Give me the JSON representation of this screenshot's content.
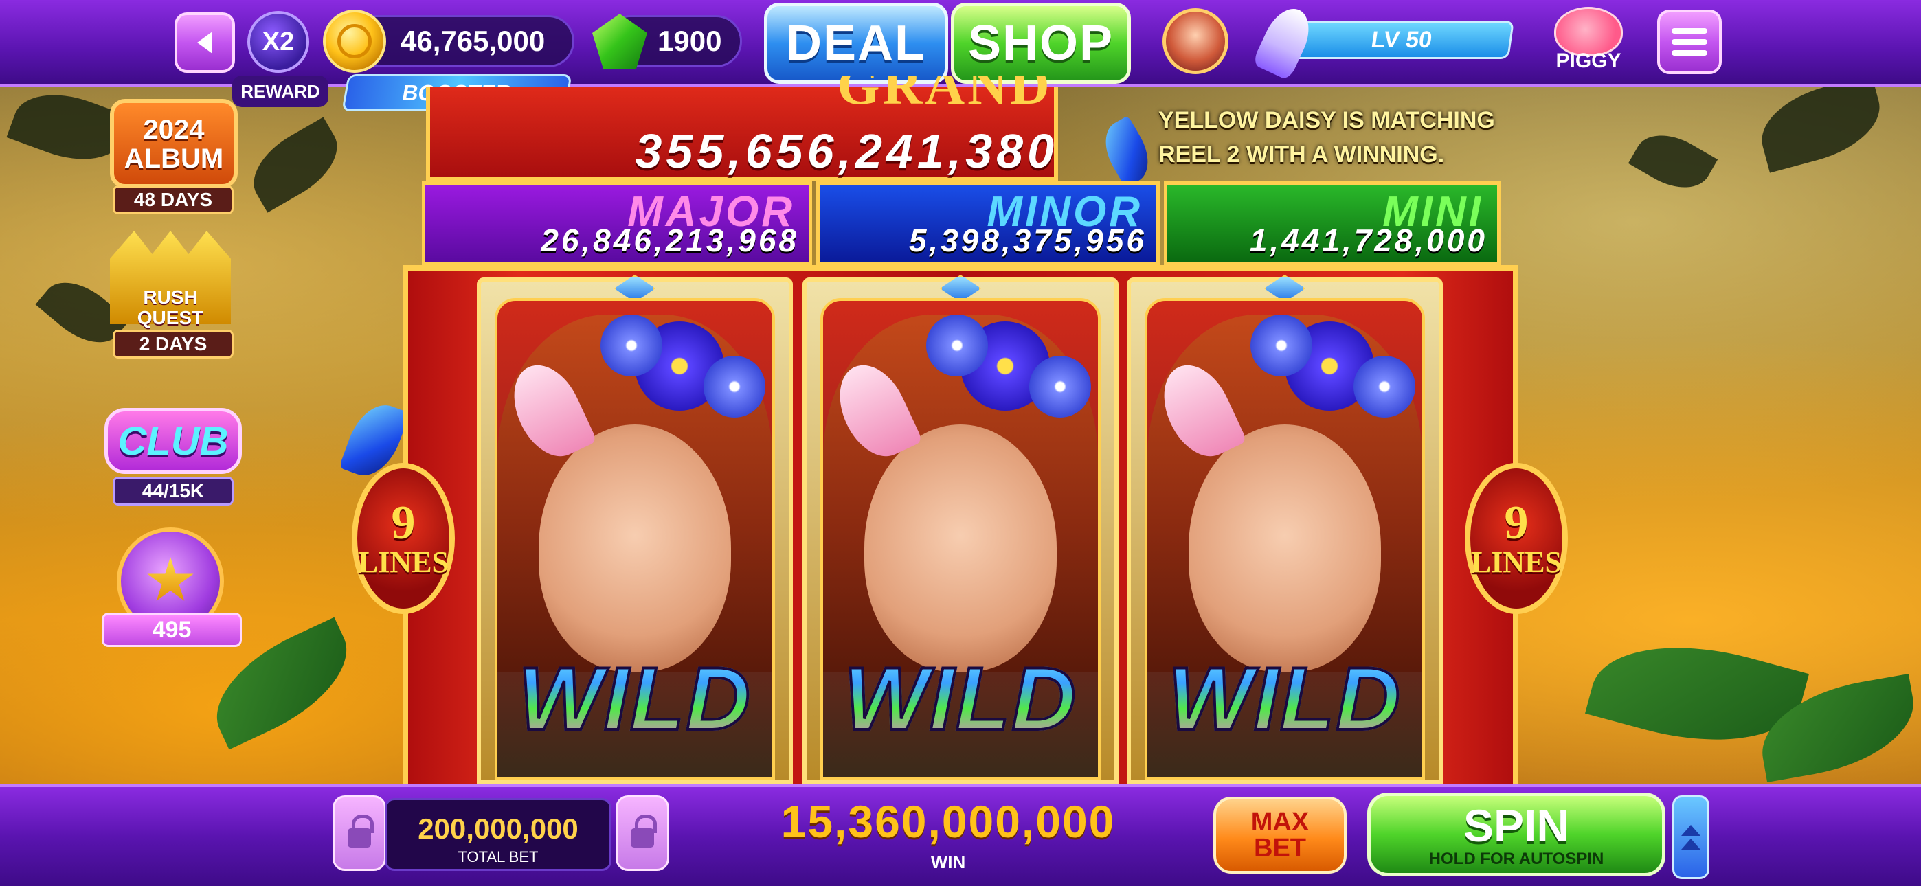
{
  "topbar": {
    "reward_multiplier": "X2",
    "reward_label": "REWARD",
    "coins": "46,765,000",
    "gems": "1900",
    "deal_label": "DEAL",
    "shop_label": "SHOP",
    "booster_label": "BOOSTER",
    "level_label": "LV 50",
    "piggy_label": "PIGGY",
    "icons": [
      "back-icon",
      "coin-icon",
      "gem-icon",
      "avatar",
      "rocket-icon",
      "piggy-icon",
      "menu-icon"
    ]
  },
  "sidebar": {
    "album_title": "2024 ALBUM",
    "album_days": "48 DAYS",
    "rush_title": "RUSH QUEST",
    "rush_days": "2 DAYS",
    "club_title": "CLUB",
    "club_progress": "44/15K",
    "trophy_value": "495"
  },
  "jackpots": {
    "grand_label": "GRAND",
    "grand_value": "355,656,241,380",
    "major_label": "MAJOR",
    "major_value": "26,846,213,968",
    "minor_label": "MINOR",
    "minor_value": "5,398,375,956",
    "mini_label": "MINI",
    "mini_value": "1,441,728,000"
  },
  "message": "YELLOW DAISY IS MATCHING REEL 2 WITH A WINNING.",
  "reels": [
    {
      "symbol": "WILD"
    },
    {
      "symbol": "WILD"
    },
    {
      "symbol": "WILD"
    }
  ],
  "lines": {
    "count": "9",
    "label": "LINES"
  },
  "bottombar": {
    "total_bet": "200,000,000",
    "total_bet_label": "TOTAL BET",
    "win": "15,360,000,000",
    "win_label": "WIN",
    "maxbet_label": "MAX BET",
    "spin_label": "SPIN",
    "spin_sub": "HOLD FOR AUTOSPIN"
  },
  "colors": {
    "bar_purple": "#5a14b0",
    "gold": "#ffcf50",
    "deal_blue": "#2e8ff0",
    "shop_green": "#4fd42a",
    "spin_green": "#4fd42a",
    "maxbet_orange": "#ff8a1a",
    "win_yellow": "#ffc21a"
  }
}
